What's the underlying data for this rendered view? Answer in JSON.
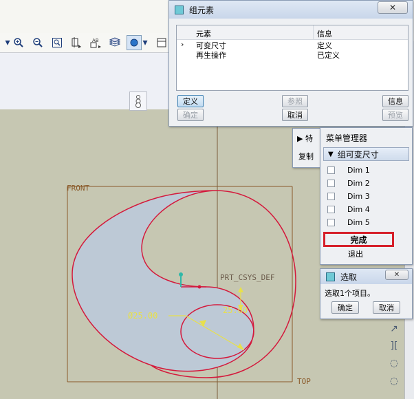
{
  "toolbar": {
    "icons": [
      "dropdown-icon",
      "zoom-in-icon",
      "zoom-out-icon",
      "refit-icon",
      "datum-icon",
      "text-label-icon",
      "layers-icon",
      "spin-center-icon",
      "dropdown-icon",
      "window-icon"
    ]
  },
  "group_dialog": {
    "title": "组元素",
    "close": "✕",
    "col_element": "元素",
    "col_info": "信息",
    "rows": [
      {
        "marker": "›",
        "element": "可变尺寸",
        "info": "定义"
      },
      {
        "marker": "",
        "element": "再生操作",
        "info": "已定义"
      }
    ],
    "btn_define": "定义",
    "btn_reference": "参照",
    "btn_info": "信息",
    "btn_ok": "确定",
    "btn_cancel": "取消",
    "btn_preview": "预览"
  },
  "behind_panel": {
    "arrow": "▶",
    "text": "特",
    "copy": "复制"
  },
  "menu_manager": {
    "title": "菜单管理器",
    "section": "组可变尺寸",
    "items": [
      "Dim 1",
      "Dim 2",
      "Dim 3",
      "Dim 4",
      "Dim 5"
    ],
    "done": "完成",
    "quit": "退出"
  },
  "select_dialog": {
    "title": "选取",
    "close": "✕",
    "message": "选取1个项目。",
    "btn_ok": "确定",
    "btn_cancel": "取消"
  },
  "sketch": {
    "label_front": "FRONT",
    "label_top": "TOP",
    "label_csys": "PRT_CSYS_DEF",
    "dim_diameter": "Ø25.00",
    "dim_linear": "25.00"
  },
  "colors": {
    "canvas": "#c6c7b2",
    "shape_fill": "#bdc9d6",
    "shape_outline": "#d4193c",
    "dim_text": "#e8e04a",
    "datum": "#8a5a2a",
    "highlight": "#d6202a"
  }
}
